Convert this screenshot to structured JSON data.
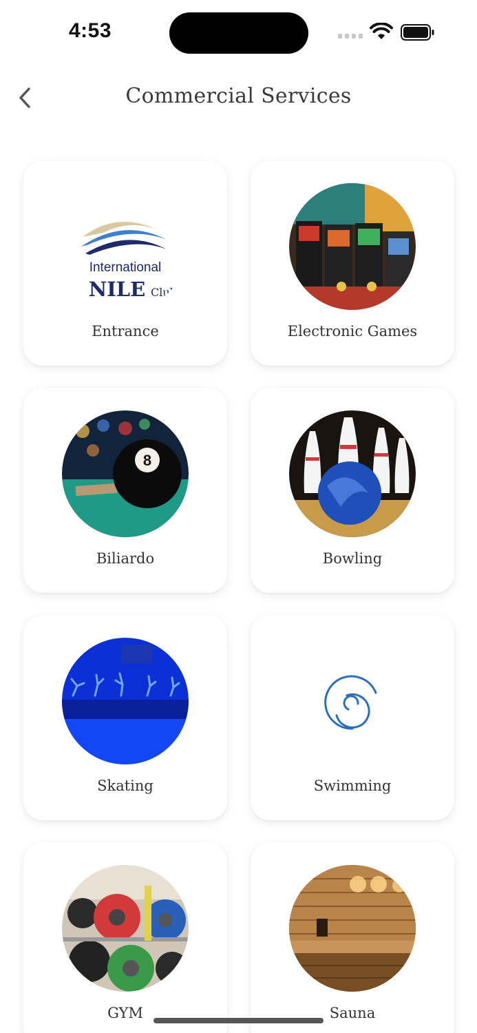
{
  "status_bar": {
    "time": "4:53",
    "icons": [
      "signal-icon",
      "wifi-icon",
      "battery-icon"
    ]
  },
  "header": {
    "title": "Commercial Services",
    "back_icon": "chevron-left-icon"
  },
  "services": [
    {
      "label": "Entrance",
      "image": "international-nile-club-logo"
    },
    {
      "label": "Electronic Games",
      "image": "arcade-machines-photo"
    },
    {
      "label": "Biliardo",
      "image": "billiard-eight-ball-photo"
    },
    {
      "label": "Bowling",
      "image": "bowling-pins-photo"
    },
    {
      "label": "Skating",
      "image": "ice-skating-rink-photo"
    },
    {
      "label": "Swimming",
      "image": "loading-spinner-icon"
    },
    {
      "label": "GYM",
      "image": "gym-weights-photo"
    },
    {
      "label": "Sauna",
      "image": "sauna-room-photo"
    }
  ],
  "logo": {
    "line1": "International",
    "line2": "NILE",
    "line3": "Club"
  },
  "colors": {
    "accent": "#2a6fbf",
    "card_bg": "#ffffff",
    "text": "#333333",
    "logo_navy": "#1d2a6b"
  }
}
